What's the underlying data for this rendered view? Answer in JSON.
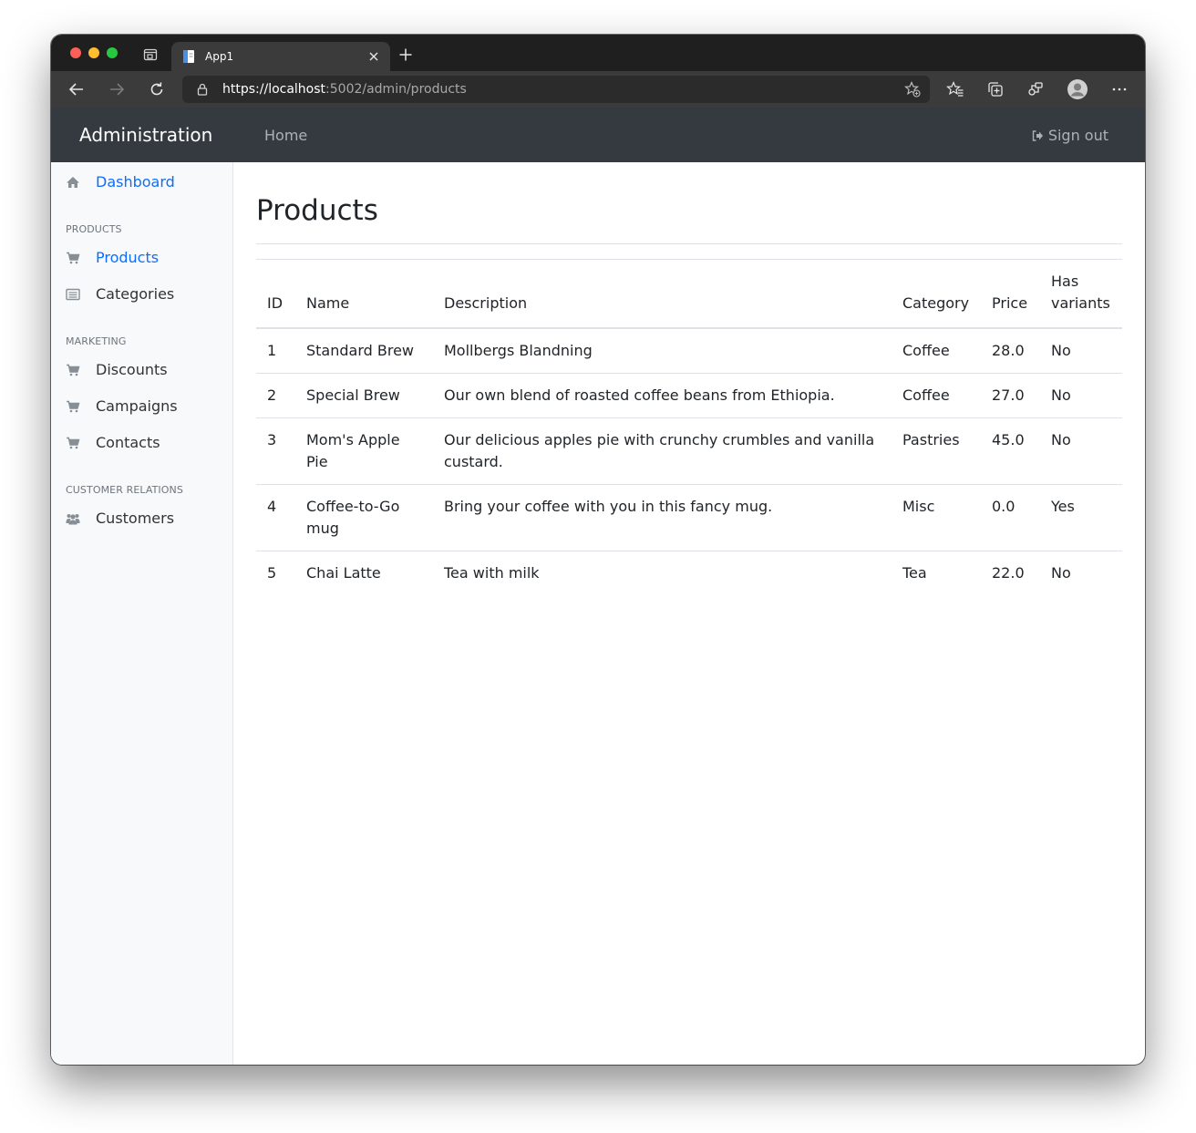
{
  "browser": {
    "tab_title": "App1",
    "url": {
      "scheme": "https://",
      "host": "localhost",
      "rest": ":5002/admin/products"
    }
  },
  "navbar": {
    "brand": "Administration",
    "home": "Home",
    "sign_out": "Sign out"
  },
  "sidebar": {
    "dashboard": "Dashboard",
    "sections": [
      {
        "heading": "PRODUCTS",
        "items": [
          "Products",
          "Categories"
        ]
      },
      {
        "heading": "MARKETING",
        "items": [
          "Discounts",
          "Campaigns",
          "Contacts"
        ]
      },
      {
        "heading": "CUSTOMER RELATIONS",
        "items": [
          "Customers"
        ]
      }
    ]
  },
  "main": {
    "title": "Products",
    "columns": [
      "ID",
      "Name",
      "Description",
      "Category",
      "Price",
      "Has variants"
    ],
    "rows": [
      {
        "id": "1",
        "name": "Standard Brew",
        "description": "Mollbergs Blandning",
        "category": "Coffee",
        "price": "28.0",
        "has_variants": "No"
      },
      {
        "id": "2",
        "name": "Special Brew",
        "description": "Our own blend of roasted coffee beans from Ethiopia.",
        "category": "Coffee",
        "price": "27.0",
        "has_variants": "No"
      },
      {
        "id": "3",
        "name": "Mom's Apple Pie",
        "description": "Our delicious apples pie with crunchy crumbles and vanilla custard.",
        "category": "Pastries",
        "price": "45.0",
        "has_variants": "No"
      },
      {
        "id": "4",
        "name": "Coffee-to-Go mug",
        "description": "Bring your coffee with you in this fancy mug.",
        "category": "Misc",
        "price": "0.0",
        "has_variants": "Yes"
      },
      {
        "id": "5",
        "name": "Chai Latte",
        "description": "Tea with milk",
        "category": "Tea",
        "price": "22.0",
        "has_variants": "No"
      }
    ]
  }
}
